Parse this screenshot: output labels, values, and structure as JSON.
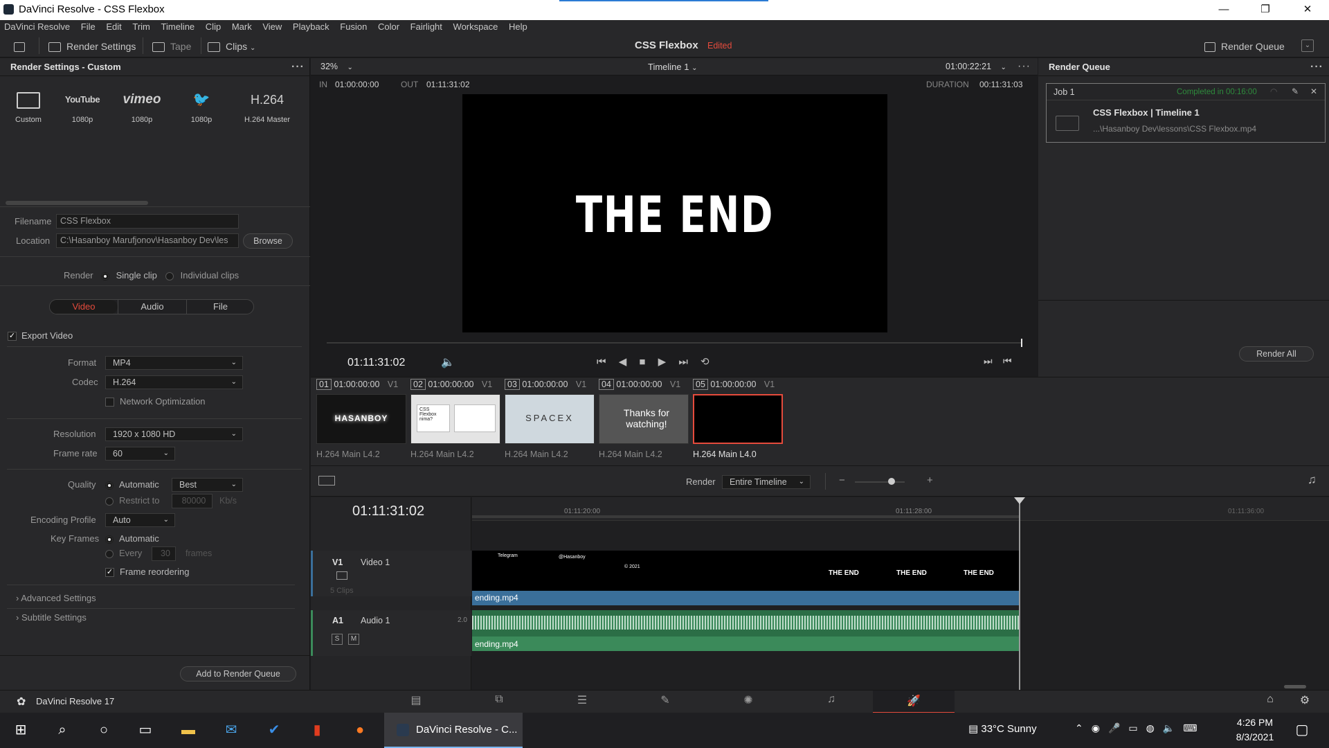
{
  "window": {
    "title": "DaVinci Resolve - CSS Flexbox",
    "min": "—",
    "max": "❐",
    "close": "✕"
  },
  "menu": [
    "DaVinci Resolve",
    "File",
    "Edit",
    "Trim",
    "Timeline",
    "Clip",
    "Mark",
    "View",
    "Playback",
    "Fusion",
    "Color",
    "Fairlight",
    "Workspace",
    "Help"
  ],
  "toolbar": {
    "render_settings": "Render Settings",
    "tape": "Tape",
    "clips": "Clips",
    "project": "CSS Flexbox",
    "edited": "Edited",
    "render_queue": "Render Queue"
  },
  "render_settings": {
    "title": "Render Settings - Custom",
    "presets": [
      {
        "icon": "film",
        "label": "Custom"
      },
      {
        "icon": "YouTube",
        "label": "1080p"
      },
      {
        "icon": "vimeo",
        "label": "1080p"
      },
      {
        "icon": "twitter",
        "label": "1080p"
      },
      {
        "icon": "H.264",
        "label": "H.264 Master"
      }
    ],
    "filename_label": "Filename",
    "filename": "CSS Flexbox",
    "location_label": "Location",
    "location": "C:\\Hasanboy Marufjonov\\Hasanboy Dev\\les",
    "browse": "Browse",
    "render_label": "Render",
    "single_clip": "Single clip",
    "individual_clips": "Individual clips",
    "tabs": [
      "Video",
      "Audio",
      "File"
    ],
    "export_video": "Export Video",
    "format_label": "Format",
    "format": "MP4",
    "codec_label": "Codec",
    "codec": "H.264",
    "network_opt": "Network Optimization",
    "resolution_label": "Resolution",
    "resolution": "1920 x 1080 HD",
    "framerate_label": "Frame rate",
    "framerate": "60",
    "quality_label": "Quality",
    "quality_auto": "Automatic",
    "quality_best": "Best",
    "restrict_to": "Restrict to",
    "restrict_val": "80000",
    "restrict_unit": "Kb/s",
    "encoding_label": "Encoding Profile",
    "encoding": "Auto",
    "keyframes_label": "Key Frames",
    "kf_auto": "Automatic",
    "kf_every": "Every",
    "kf_val": "30",
    "kf_unit": "frames",
    "frame_reorder": "Frame reordering",
    "advanced": "Advanced Settings",
    "subtitle": "Subtitle Settings",
    "add_queue": "Add to Render Queue"
  },
  "viewer": {
    "zoom": "32%",
    "timeline_name": "Timeline 1",
    "timecode_top": "01:00:22:21",
    "in_label": "IN",
    "in": "01:00:00:00",
    "out_label": "OUT",
    "out": "01:11:31:02",
    "duration_label": "DURATION",
    "duration": "00:11:31:03",
    "frame_text": "THE END",
    "playhead_tc": "01:11:31:02"
  },
  "queue": {
    "title": "Render Queue",
    "job": "Job 1",
    "status": "Completed in 00:16:00",
    "item_title": "CSS Flexbox | Timeline 1",
    "item_path": "...\\Hasanboy Dev\\lessons\\CSS Flexbox.mp4",
    "render_all": "Render All"
  },
  "clips": [
    {
      "num": "01",
      "tc": "01:00:00:00",
      "track": "V1",
      "codec": "H.264 Main L4.2",
      "thumb": "HASANBOY"
    },
    {
      "num": "02",
      "tc": "01:00:00:00",
      "track": "V1",
      "codec": "H.264 Main L4.2",
      "thumb": "CSS Flexbox nima?"
    },
    {
      "num": "03",
      "tc": "01:00:00:00",
      "track": "V1",
      "codec": "H.264 Main L4.2",
      "thumb": "SPACEX"
    },
    {
      "num": "04",
      "tc": "01:00:00:00",
      "track": "V1",
      "codec": "H.264 Main L4.2",
      "thumb": "Thanks for watching!"
    },
    {
      "num": "05",
      "tc": "01:00:00:00",
      "track": "V1",
      "codec": "H.264 Main L4.0",
      "thumb": ""
    }
  ],
  "timeline": {
    "render_label": "Render",
    "render_mode": "Entire Timeline",
    "timecode": "01:11:31:02",
    "ruler": [
      "01:11:20:00",
      "01:11:28:00",
      "01:11:36:00"
    ],
    "v1": "V1",
    "v1_name": "Video 1",
    "v1_clips": "5 Clips",
    "a1": "A1",
    "a1_name": "Audio 1",
    "a1_ch": "2.0",
    "clip_name": "ending.mp4",
    "s_btn": "S",
    "m_btn": "M",
    "strip_texts": [
      "Telegram",
      "@Hasanboy",
      "© 2021 ",
      "THE END",
      "THE END",
      "THE END"
    ]
  },
  "bottom": {
    "app": "DaVinci Resolve 17"
  },
  "taskbar": {
    "app_label": "DaVinci Resolve - C...",
    "weather": "33°C  Sunny",
    "time": "4:26 PM",
    "date": "8/3/2021"
  },
  "colors": {
    "accent_red": "#e64b3c",
    "completed_green": "#2e8b3c",
    "video_blue": "#3a6f9a",
    "audio_green": "#3b8a5a"
  }
}
